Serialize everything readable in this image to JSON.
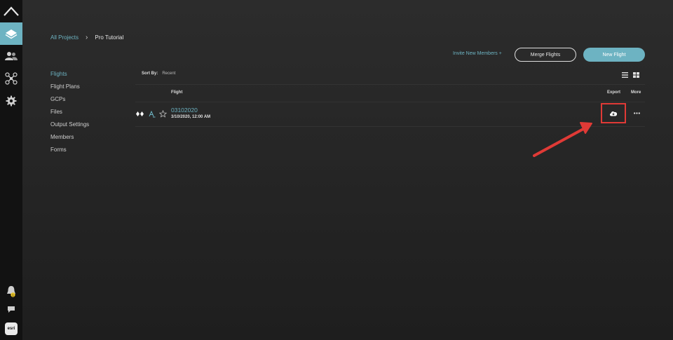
{
  "breadcrumb": {
    "root": "All Projects",
    "separator": "›",
    "current": "Pro Tutorial"
  },
  "actions": {
    "invite": "Invite New Members +",
    "merge": "Merge Flights",
    "new_flight": "New Flight"
  },
  "menu": [
    {
      "label": "Flights",
      "active": true
    },
    {
      "label": "Flight Plans"
    },
    {
      "label": "GCPs"
    },
    {
      "label": "Files"
    },
    {
      "label": "Output Settings"
    },
    {
      "label": "Members"
    },
    {
      "label": "Forms"
    }
  ],
  "sort": {
    "label": "Sort By:",
    "value": "Recent"
  },
  "columns": {
    "flight": "Flight",
    "export": "Export",
    "more": "More"
  },
  "flights": [
    {
      "name": "03102020",
      "date": "3/10/2020, 12:00 AM"
    }
  ],
  "rail": {
    "esri_label": "esri",
    "notification_count": "1"
  },
  "colors": {
    "accent": "#6db3c2",
    "highlight": "#e03a36"
  },
  "icons": {
    "rail": [
      "drone-deploy-logo-icon",
      "layers-icon",
      "people-icon",
      "drone-icon",
      "gear-icon",
      "bell-icon",
      "chat-icon",
      "esri-icon"
    ],
    "row": [
      "diamond-pair-icon",
      "text-annotation-icon",
      "star-icon",
      "cloud-download-icon",
      "more-dots-icon"
    ]
  }
}
